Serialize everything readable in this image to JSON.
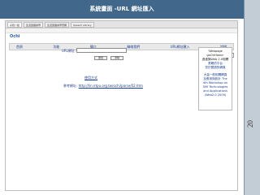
{
  "slide": {
    "title": "系統畫面 -URL 網址匯入",
    "page_number": "20"
  },
  "browser": {
    "tabs": [
      "系統介紹",
      "生活單語言學",
      "生活單語言學習網",
      "Speech Library"
    ]
  },
  "site": {
    "logo": "Ochi",
    "nav": [
      "首頁",
      "功能",
      "簡介",
      "聯絡我們",
      "URL網址匯入",
      "說明"
    ],
    "util_label": "訪客模式"
  },
  "form": {
    "url_label": "URL網址:",
    "button1": "送出",
    "button2": "清除",
    "usage_link": "使用方式",
    "example_label": "參考網址:",
    "example_url": "http://lin.ntpu.org.tw/ochi/parse/02.htm"
  },
  "ad": {
    "lines_dark": [
      "'Webpage",
      "goOnHome'",
      "過濾與Web 2.0相關"
    ],
    "lines_blue_1": [
      "書籍的平台",
      "您於閱讀的網頁"
    ],
    "lines_blue_2": [
      "大量一般相關網頁",
      "及應用與設計 The",
      "4th Workshop on",
      "SMI Technologies",
      "and Applications",
      "(Web2.0 2009)"
    ]
  }
}
